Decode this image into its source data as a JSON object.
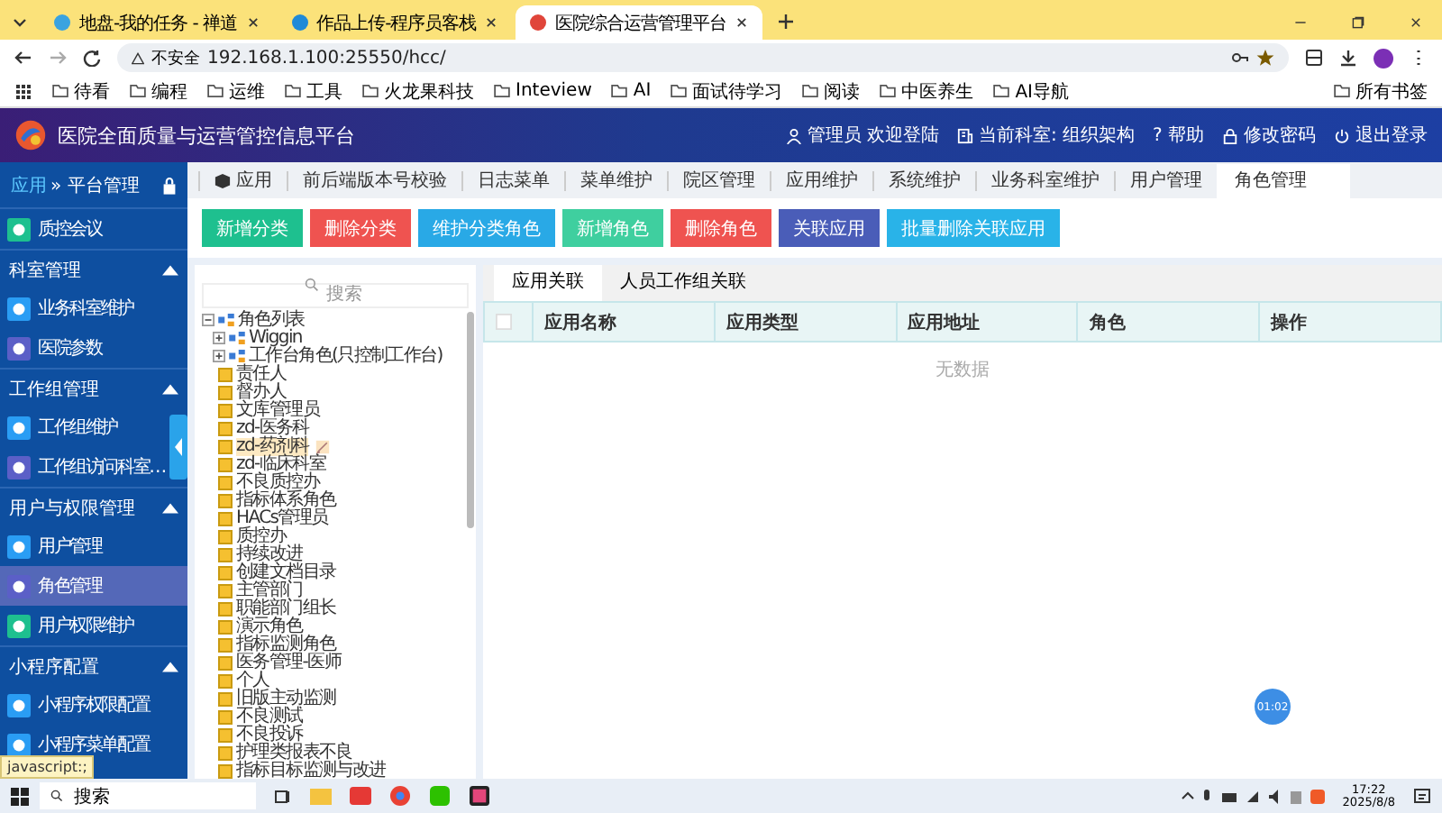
{
  "browser": {
    "tabs": [
      {
        "title": "地盘-我的任务 - 禅道",
        "selected": false
      },
      {
        "title": "作品上传-程序员客栈",
        "selected": false
      },
      {
        "title": "医院综合运营管理平台",
        "selected": true
      }
    ],
    "security": "不安全",
    "url": "192.168.1.100:25550/hcc/",
    "bookmarks": [
      "待看",
      "编程",
      "运维",
      "工具",
      "火龙果科技",
      "Inteview",
      "AI",
      "面试待学习",
      "阅读",
      "中医养生",
      "AI导航"
    ],
    "all_bookmarks": "所有书签"
  },
  "header": {
    "title": "医院全面质量与运营管控信息平台",
    "links": [
      {
        "kind": "user",
        "label": "管理员 欢迎登陆"
      },
      {
        "kind": "dept",
        "label": "当前科室: 组织架构"
      },
      {
        "kind": "help",
        "label": "? 帮助"
      },
      {
        "kind": "lock",
        "label": "修改密码"
      },
      {
        "kind": "power",
        "label": "退出登录"
      }
    ]
  },
  "sidebar": {
    "app": "应用",
    "arrow": "»",
    "current": "平台管理",
    "items": [
      {
        "kind": "item",
        "label": "质控会议",
        "selected": false
      },
      {
        "kind": "section",
        "label": "科室管理",
        "expanded": true
      },
      {
        "kind": "item",
        "label": "业务科室维护",
        "selected": false
      },
      {
        "kind": "item",
        "label": "医院参数",
        "selected": false
      },
      {
        "kind": "section",
        "label": "工作组管理",
        "expanded": true
      },
      {
        "kind": "item",
        "label": "工作组维护",
        "selected": false
      },
      {
        "kind": "item",
        "label": "工作组访问科室…",
        "selected": false
      },
      {
        "kind": "section",
        "label": "用户与权限管理",
        "expanded": true
      },
      {
        "kind": "item",
        "label": "用户管理",
        "selected": false
      },
      {
        "kind": "item",
        "label": "角色管理",
        "selected": true
      },
      {
        "kind": "item",
        "label": "用户权限维护",
        "selected": false
      },
      {
        "kind": "section",
        "label": "小程序配置",
        "expanded": true
      },
      {
        "kind": "item",
        "label": "小程序权限配置",
        "selected": false
      },
      {
        "kind": "item",
        "label": "小程序菜单配置",
        "selected": false
      }
    ]
  },
  "nav_tabs": [
    {
      "label": "应用",
      "selected": false
    },
    {
      "label": "前后端版本号校验",
      "selected": false
    },
    {
      "label": "日志菜单",
      "selected": false
    },
    {
      "label": "菜单维护",
      "selected": false
    },
    {
      "label": "院区管理",
      "selected": false
    },
    {
      "label": "应用维护",
      "selected": false
    },
    {
      "label": "系统维护",
      "selected": false
    },
    {
      "label": "业务科室维护",
      "selected": false
    },
    {
      "label": "用户管理",
      "selected": false
    },
    {
      "label": "角色管理",
      "selected": true
    }
  ],
  "buttons": [
    {
      "label": "新增分类",
      "color": "#1ec08f"
    },
    {
      "label": "删除分类",
      "color": "#ef5350"
    },
    {
      "label": "维护分类角色",
      "color": "#29a9e6"
    },
    {
      "label": "新增角色",
      "color": "#3fcf9f"
    },
    {
      "label": "删除角色",
      "color": "#ef5350"
    },
    {
      "label": "关联应用",
      "color": "#4a5db8"
    },
    {
      "label": "批量删除关联应用",
      "color": "#29b3e8"
    }
  ],
  "tree": {
    "search": {
      "placeholder": "搜索"
    },
    "nodes": [
      {
        "kind": "group",
        "label": "角色列表",
        "expanded": true,
        "children": [
          {
            "kind": "group",
            "label": "Wiggin",
            "expanded": false
          },
          {
            "kind": "group",
            "label": "工作台角色(只控制工作台)",
            "expanded": false
          },
          {
            "kind": "role",
            "label": "责任人",
            "selected": false
          },
          {
            "kind": "role",
            "label": "督办人",
            "selected": false
          },
          {
            "kind": "role",
            "label": "文库管理员",
            "selected": false
          },
          {
            "kind": "role",
            "label": "zd-医务科",
            "selected": false
          },
          {
            "kind": "role",
            "label": "zd-药剂科",
            "selected": true
          },
          {
            "kind": "role",
            "label": "zd-临床科室",
            "selected": false
          },
          {
            "kind": "role",
            "label": "不良质控办",
            "selected": false
          },
          {
            "kind": "role",
            "label": "指标体系角色",
            "selected": false
          },
          {
            "kind": "role",
            "label": "HACs管理员",
            "selected": false
          },
          {
            "kind": "role",
            "label": "质控办",
            "selected": false
          },
          {
            "kind": "role",
            "label": "持续改进",
            "selected": false
          },
          {
            "kind": "role",
            "label": "创建文档目录",
            "selected": false
          },
          {
            "kind": "role",
            "label": "主管部门",
            "selected": false
          },
          {
            "kind": "role",
            "label": "职能部门组长",
            "selected": false
          },
          {
            "kind": "role",
            "label": "演示角色",
            "selected": false
          },
          {
            "kind": "role",
            "label": "指标监测角色",
            "selected": false
          },
          {
            "kind": "role",
            "label": "医务管理-医师",
            "selected": false
          },
          {
            "kind": "role",
            "label": "个人",
            "selected": false
          },
          {
            "kind": "role",
            "label": "旧版主动监测",
            "selected": false
          },
          {
            "kind": "role",
            "label": "不良测试",
            "selected": false
          },
          {
            "kind": "role",
            "label": "不良投诉",
            "selected": false
          },
          {
            "kind": "role",
            "label": "护理类报表不良",
            "selected": false
          },
          {
            "kind": "role",
            "label": "指标目标监测与改进",
            "selected": false
          }
        ]
      }
    ]
  },
  "detail_tabs": [
    {
      "label": "应用关联",
      "selected": true
    },
    {
      "label": "人员工作组关联",
      "selected": false
    }
  ],
  "table": {
    "select_all": {
      "checked": false
    },
    "columns": [
      "应用名称",
      "应用类型",
      "应用地址",
      "角色",
      "操作"
    ],
    "empty": "无数据"
  },
  "timer": "01:02",
  "status_link": "javascript:;",
  "taskbar": {
    "search": "搜索",
    "time": "17:22",
    "date": "2025/8/8"
  }
}
